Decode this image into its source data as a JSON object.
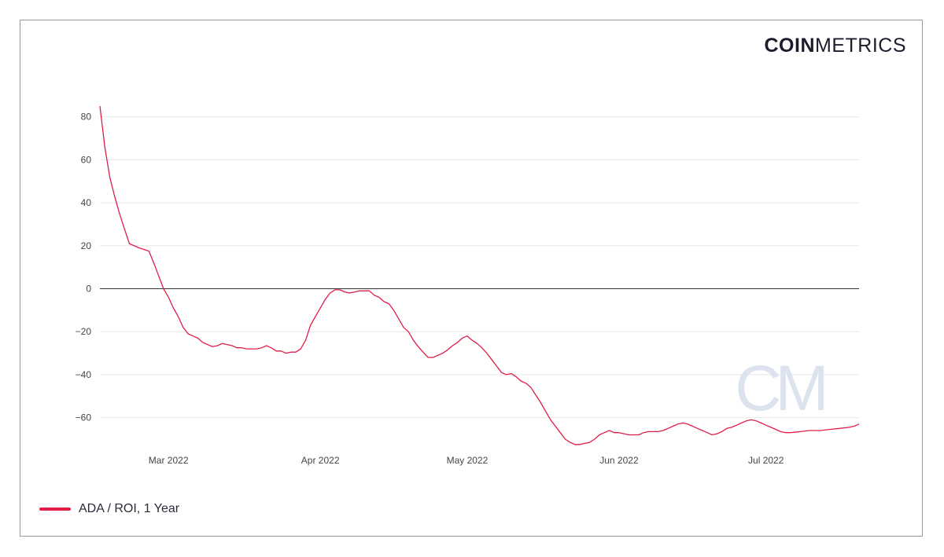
{
  "brand": {
    "bold": "COIN",
    "light": "METRICS"
  },
  "watermark": "CM",
  "colors": {
    "series": "#e11d48",
    "grid": "#e6e6e6",
    "zero_line": "#333333"
  },
  "chart_data": {
    "type": "line",
    "title": "",
    "xlabel": "",
    "ylabel": "",
    "ylim": [
      -75,
      85
    ],
    "y_ticks": [
      80,
      60,
      40,
      20,
      0,
      -20,
      -40,
      -60
    ],
    "x_ticks": [
      {
        "date": "2022-03-01",
        "label": "Mar 2022"
      },
      {
        "date": "2022-04-01",
        "label": "Apr 2022"
      },
      {
        "date": "2022-05-01",
        "label": "May 2022"
      },
      {
        "date": "2022-06-01",
        "label": "Jun 2022"
      },
      {
        "date": "2022-07-01",
        "label": "Jul 2022"
      }
    ],
    "x_range": [
      "2022-02-15",
      "2022-07-20"
    ],
    "grid": true,
    "legend": "bottom-left",
    "series": [
      {
        "name": "ADA / ROI, 1 Year",
        "points": [
          [
            "2022-02-15",
            85
          ],
          [
            "2022-02-16",
            66
          ],
          [
            "2022-02-17",
            52
          ],
          [
            "2022-02-18",
            43
          ],
          [
            "2022-02-19",
            35
          ],
          [
            "2022-02-20",
            28
          ],
          [
            "2022-02-21",
            21
          ],
          [
            "2022-02-23",
            19
          ],
          [
            "2022-02-25",
            17.5
          ],
          [
            "2022-02-26",
            12
          ],
          [
            "2022-02-27",
            6
          ],
          [
            "2022-02-28",
            0
          ],
          [
            "2022-03-01",
            -4
          ],
          [
            "2022-03-02",
            -9
          ],
          [
            "2022-03-03",
            -13
          ],
          [
            "2022-03-04",
            -18
          ],
          [
            "2022-03-05",
            -21
          ],
          [
            "2022-03-06",
            -22
          ],
          [
            "2022-03-07",
            -23
          ],
          [
            "2022-03-08",
            -25
          ],
          [
            "2022-03-09",
            -26
          ],
          [
            "2022-03-10",
            -27
          ],
          [
            "2022-03-11",
            -26.5
          ],
          [
            "2022-03-12",
            -25.5
          ],
          [
            "2022-03-13",
            -26
          ],
          [
            "2022-03-14",
            -26.5
          ],
          [
            "2022-03-15",
            -27.5
          ],
          [
            "2022-03-16",
            -27.5
          ],
          [
            "2022-03-17",
            -28
          ],
          [
            "2022-03-18",
            -28
          ],
          [
            "2022-03-19",
            -28
          ],
          [
            "2022-03-20",
            -27.5
          ],
          [
            "2022-03-21",
            -26.5
          ],
          [
            "2022-03-22",
            -27.5
          ],
          [
            "2022-03-23",
            -29
          ],
          [
            "2022-03-24",
            -29
          ],
          [
            "2022-03-25",
            -30
          ],
          [
            "2022-03-26",
            -29.5
          ],
          [
            "2022-03-27",
            -29.5
          ],
          [
            "2022-03-28",
            -28
          ],
          [
            "2022-03-29",
            -24
          ],
          [
            "2022-03-30",
            -17
          ],
          [
            "2022-03-31",
            -13
          ],
          [
            "2022-04-01",
            -9
          ],
          [
            "2022-04-02",
            -5
          ],
          [
            "2022-04-03",
            -2
          ],
          [
            "2022-04-04",
            -0.5
          ],
          [
            "2022-04-05",
            -0.5
          ],
          [
            "2022-04-06",
            -1.5
          ],
          [
            "2022-04-07",
            -2
          ],
          [
            "2022-04-08",
            -1.5
          ],
          [
            "2022-04-09",
            -1
          ],
          [
            "2022-04-10",
            -1
          ],
          [
            "2022-04-11",
            -1
          ],
          [
            "2022-04-12",
            -3
          ],
          [
            "2022-04-13",
            -4
          ],
          [
            "2022-04-14",
            -6
          ],
          [
            "2022-04-15",
            -7
          ],
          [
            "2022-04-16",
            -10
          ],
          [
            "2022-04-17",
            -14
          ],
          [
            "2022-04-18",
            -18
          ],
          [
            "2022-04-19",
            -20
          ],
          [
            "2022-04-20",
            -24
          ],
          [
            "2022-04-21",
            -27
          ],
          [
            "2022-04-22",
            -29.5
          ],
          [
            "2022-04-23",
            -32
          ],
          [
            "2022-04-24",
            -32
          ],
          [
            "2022-04-25",
            -31
          ],
          [
            "2022-04-26",
            -30
          ],
          [
            "2022-04-27",
            -28.5
          ],
          [
            "2022-04-28",
            -26.5
          ],
          [
            "2022-04-29",
            -25
          ],
          [
            "2022-04-30",
            -23
          ],
          [
            "2022-05-01",
            -22
          ],
          [
            "2022-05-02",
            -24
          ],
          [
            "2022-05-03",
            -25.5
          ],
          [
            "2022-05-04",
            -27.5
          ],
          [
            "2022-05-05",
            -30
          ],
          [
            "2022-05-06",
            -33
          ],
          [
            "2022-05-07",
            -36
          ],
          [
            "2022-05-08",
            -39
          ],
          [
            "2022-05-09",
            -40
          ],
          [
            "2022-05-10",
            -39.5
          ],
          [
            "2022-05-11",
            -41
          ],
          [
            "2022-05-12",
            -43
          ],
          [
            "2022-05-13",
            -44
          ],
          [
            "2022-05-14",
            -46
          ],
          [
            "2022-05-15",
            -49.5
          ],
          [
            "2022-05-16",
            -53
          ],
          [
            "2022-05-17",
            -57
          ],
          [
            "2022-05-18",
            -61
          ],
          [
            "2022-05-19",
            -64
          ],
          [
            "2022-05-20",
            -67
          ],
          [
            "2022-05-21",
            -70
          ],
          [
            "2022-05-22",
            -71.5
          ],
          [
            "2022-05-23",
            -72.5
          ],
          [
            "2022-05-24",
            -72.5
          ],
          [
            "2022-05-25",
            -72
          ],
          [
            "2022-05-26",
            -71.5
          ],
          [
            "2022-05-27",
            -70
          ],
          [
            "2022-05-28",
            -68
          ],
          [
            "2022-05-29",
            -67
          ],
          [
            "2022-05-30",
            -66
          ],
          [
            "2022-05-31",
            -67
          ],
          [
            "2022-06-01",
            -67
          ],
          [
            "2022-06-02",
            -67.5
          ],
          [
            "2022-06-03",
            -68
          ],
          [
            "2022-06-04",
            -68
          ],
          [
            "2022-06-05",
            -68
          ],
          [
            "2022-06-06",
            -67
          ],
          [
            "2022-06-07",
            -66.5
          ],
          [
            "2022-06-08",
            -66.5
          ],
          [
            "2022-06-09",
            -66.5
          ],
          [
            "2022-06-10",
            -66
          ],
          [
            "2022-06-11",
            -65
          ],
          [
            "2022-06-12",
            -64
          ],
          [
            "2022-06-13",
            -63
          ],
          [
            "2022-06-14",
            -62.5
          ],
          [
            "2022-06-15",
            -63
          ],
          [
            "2022-06-16",
            -64
          ],
          [
            "2022-06-17",
            -65
          ],
          [
            "2022-06-18",
            -66
          ],
          [
            "2022-06-19",
            -67
          ],
          [
            "2022-06-20",
            -68
          ],
          [
            "2022-06-21",
            -67.5
          ],
          [
            "2022-06-22",
            -66.5
          ],
          [
            "2022-06-23",
            -65
          ],
          [
            "2022-06-24",
            -64.5
          ],
          [
            "2022-06-25",
            -63.5
          ],
          [
            "2022-06-26",
            -62.5
          ],
          [
            "2022-06-27",
            -61.5
          ],
          [
            "2022-06-28",
            -61
          ],
          [
            "2022-06-29",
            -61.5
          ],
          [
            "2022-06-30",
            -62.5
          ],
          [
            "2022-07-01",
            -63.5
          ],
          [
            "2022-07-02",
            -64.5
          ],
          [
            "2022-07-03",
            -65.5
          ],
          [
            "2022-07-04",
            -66.5
          ],
          [
            "2022-07-05",
            -67
          ],
          [
            "2022-07-06",
            -67
          ],
          [
            "2022-07-08",
            -66.5
          ],
          [
            "2022-07-10",
            -66
          ],
          [
            "2022-07-12",
            -66
          ],
          [
            "2022-07-14",
            -65.5
          ],
          [
            "2022-07-16",
            -65
          ],
          [
            "2022-07-18",
            -64.5
          ],
          [
            "2022-07-19",
            -64
          ],
          [
            "2022-07-20",
            -63
          ]
        ]
      }
    ]
  }
}
